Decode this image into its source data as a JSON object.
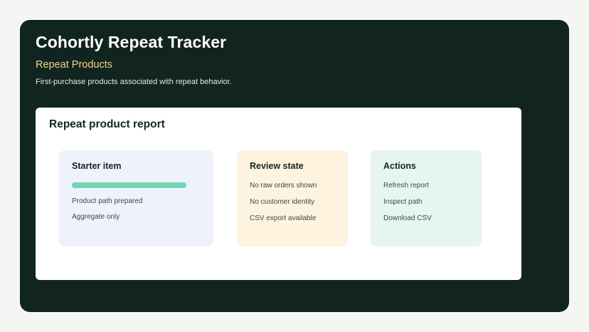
{
  "app": {
    "title": "Cohortly Repeat Tracker"
  },
  "section": {
    "title": "Repeat Products",
    "description": "First-purchase products associated with repeat behavior."
  },
  "report": {
    "title": "Repeat product report",
    "starter": {
      "title": "Starter item",
      "progress_percent": 100,
      "lines": [
        "Product path prepared",
        "Aggregate only"
      ]
    },
    "review": {
      "title": "Review state",
      "lines": [
        "No raw orders shown",
        "No customer identity",
        "CSV export available"
      ]
    },
    "actions": {
      "title": "Actions",
      "items": [
        "Refresh report",
        "Inspect path",
        "Download CSV"
      ]
    }
  },
  "colors": {
    "frame_bg": "#112420",
    "accent_title": "#f0d48a",
    "progress_fill": "#6fd6b0"
  }
}
